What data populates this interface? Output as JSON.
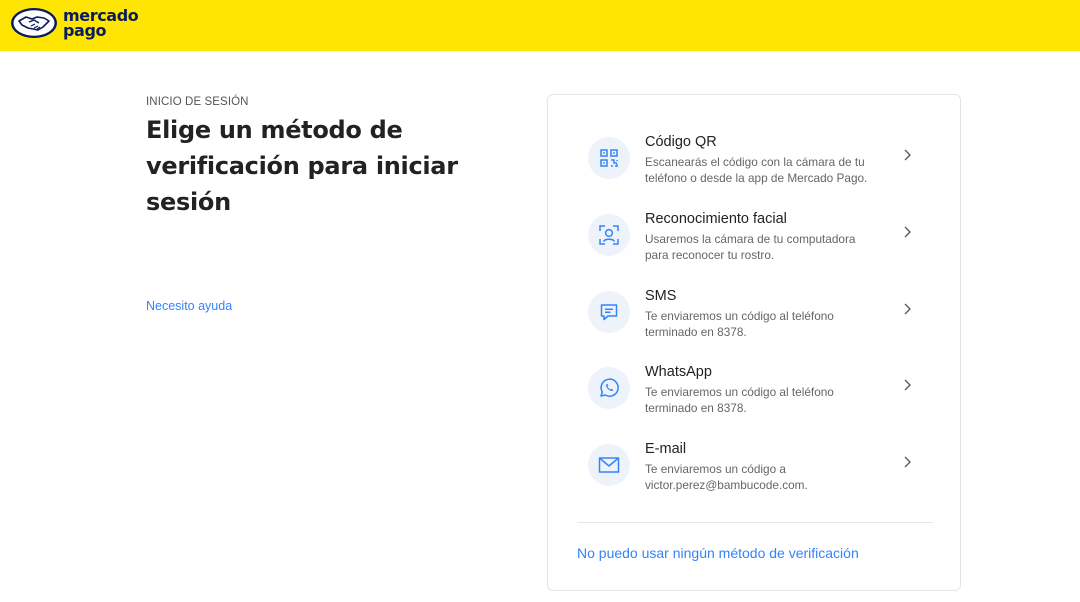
{
  "header": {
    "brand_line1": "mercado",
    "brand_line2": "pago",
    "background_color": "#ffe600",
    "brand_color": "#0a1b5e"
  },
  "intro": {
    "eyebrow": "INICIO DE SESIÓN",
    "title_lines": [
      "Elige un método de",
      "verificación para iniciar",
      "sesión"
    ],
    "help_link": "Necesito ayuda"
  },
  "methods": [
    {
      "title": "Código QR",
      "desc_lines": [
        "Escanearás el código con la cámara de tu",
        "teléfono o desde la app de Mercado Pago."
      ],
      "icon": "qr-code-icon"
    },
    {
      "title": "Reconocimiento facial",
      "desc_lines": [
        "Usaremos la cámara de tu computadora",
        "para reconocer tu rostro."
      ],
      "icon": "face-scan-icon"
    },
    {
      "title": "SMS",
      "desc_lines": [
        "Te enviaremos un código al teléfono",
        "terminado en 8378."
      ],
      "icon": "message-icon"
    },
    {
      "title": "WhatsApp",
      "desc_lines": [
        "Te enviaremos un código al teléfono",
        "terminado en 8378."
      ],
      "icon": "whatsapp-icon"
    },
    {
      "title": "E-mail",
      "desc_lines": [
        "Te enviaremos un código a",
        "victor.perez@bambucode.com."
      ],
      "icon": "envelope-icon"
    }
  ],
  "footer_link": "No puedo usar ningún método de verificación",
  "colors": {
    "accent": "#3483fa",
    "icon_background": "#eef3fb"
  }
}
